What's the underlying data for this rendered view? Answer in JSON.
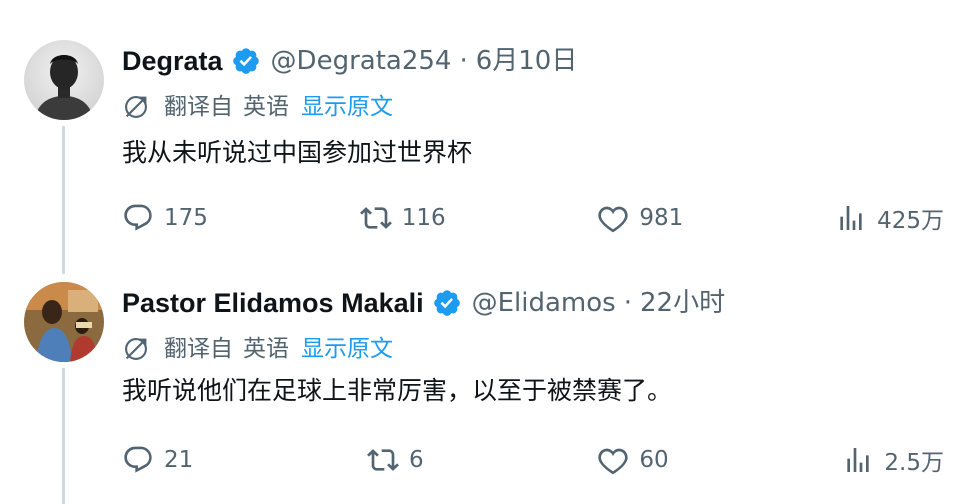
{
  "tweets": [
    {
      "name": "Degrata",
      "handle": "@Degrata254",
      "separator": "·",
      "time": "6月10日",
      "translated_from": "翻译自",
      "language": "英语",
      "show_original": "显示原文",
      "text": "我从未听说过中国参加过世界杯",
      "replies": "175",
      "retweets": "116",
      "likes": "981",
      "views": "425万"
    },
    {
      "name": "Pastor Elidamos Makali",
      "handle": "@Elidamos",
      "separator": "·",
      "time": "22小时",
      "translated_from": "翻译自",
      "language": "英语",
      "show_original": "显示原文",
      "text": "我听说他们在足球上非常厉害，以至于被禁赛了。",
      "replies": "21",
      "retweets": "6",
      "likes": "60",
      "views": "2.5万"
    }
  ],
  "colors": {
    "accent": "#1d9bf0",
    "muted": "#536471",
    "text": "#0f1419",
    "thread_line": "#cfd9de"
  }
}
